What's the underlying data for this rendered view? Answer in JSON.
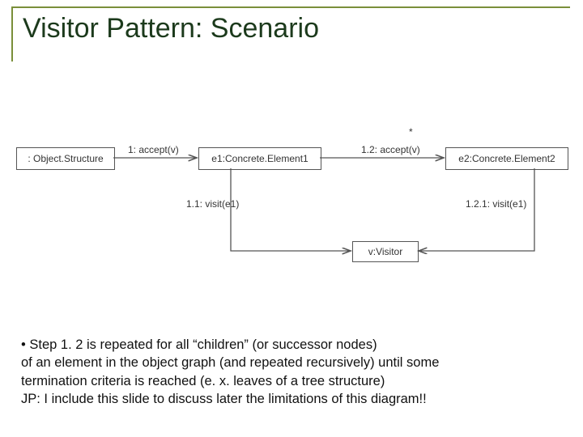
{
  "title": "Visitor Pattern: Scenario",
  "diagram": {
    "asterisk": "*",
    "nodes": {
      "os": ": Object.Structure",
      "e1": "e1:Concrete.Element1",
      "e2": "e2:Concrete.Element2",
      "v": "v:Visitor"
    },
    "edges": {
      "accept1": "1: accept(v)",
      "visit11": "1.1: visit(e1)",
      "accept12": "1.2: accept(v)",
      "visit121": "1.2.1: visit(e1)"
    }
  },
  "bullets": {
    "line1": "• Step 1. 2 is repeated for all “children” (or successor nodes)",
    "line2": "of an element in the object graph (and repeated recursively) until some",
    "line3": "termination criteria is reached (e. x. leaves of a tree structure)",
    "line4": "JP: I include this slide to discuss later the limitations of this diagram!!"
  }
}
